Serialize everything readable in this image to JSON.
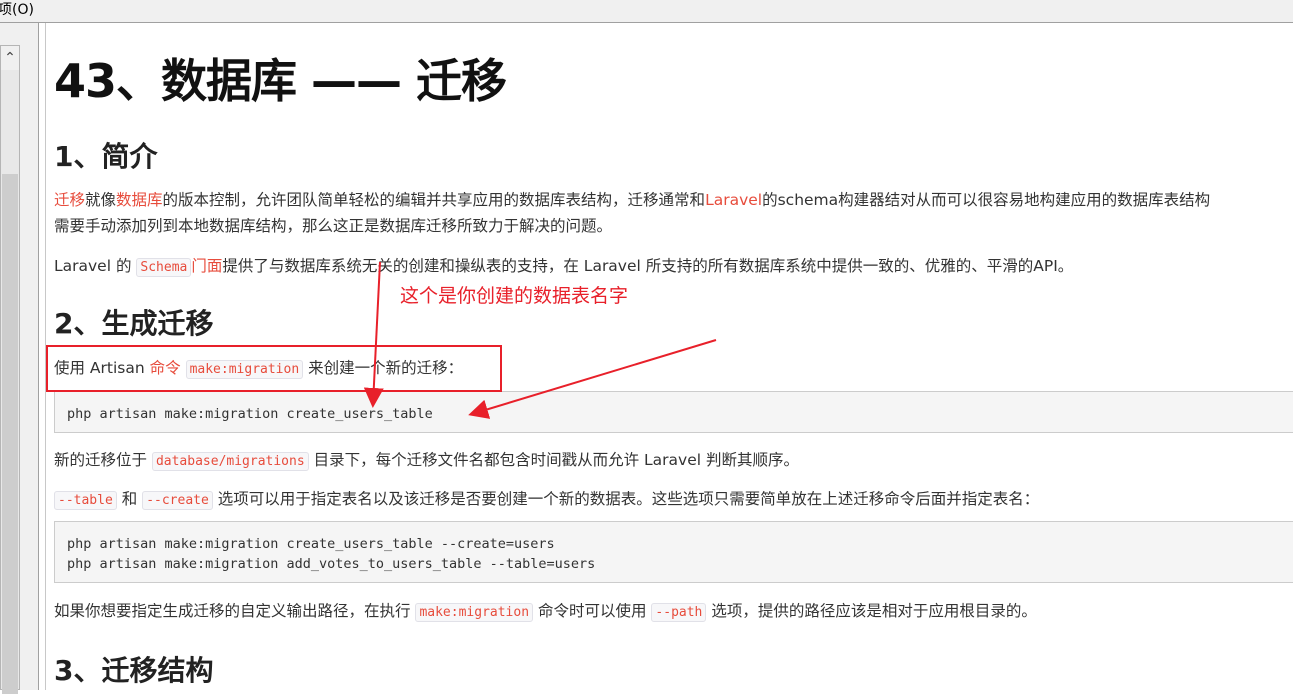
{
  "menubar": {
    "label": "项(O)"
  },
  "doc": {
    "title": "43、数据库 —— 迁移",
    "sections": [
      {
        "heading": "1、简介"
      },
      {
        "heading": "2、生成迁移"
      },
      {
        "heading": "3、迁移结构"
      }
    ],
    "intro": {
      "link1": "迁移",
      "t1": "就像",
      "link2": "数据库",
      "t2": "的版本控制，允许团队简单轻松的编辑并共享应用的数据库表结构，迁移通常和",
      "link3": "Laravel",
      "t3": "的schema构建器结对从而可以很容易地构建应用的数据库表结构",
      "line2": "需要手动添加列到本地数据库结构，那么这正是数据库迁移所致力于解决的问题。"
    },
    "schema_para": {
      "t1": "Laravel 的",
      "code": "Schema",
      "link": "门面",
      "t2": "提供了与数据库系统无关的创建和操纵表的支持，在 Laravel 所支持的所有数据库系统中提供一致的、优雅的、平滑的API。"
    },
    "gen_para": {
      "t1": "使用 Artisan",
      "link": "命令",
      "code": "make:migration",
      "t2": "来创建一个新的迁移："
    },
    "code1": "php artisan make:migration create_users_table",
    "loc_para": {
      "t1": "新的迁移位于",
      "code": "database/migrations",
      "t2": "目录下，每个迁移文件名都包含时间戳从而允许 Laravel 判断其顺序。"
    },
    "opt_para": {
      "code1": "--table",
      "t1": "和",
      "code2": "--create",
      "t2": "选项可以用于指定表名以及该迁移是否要创建一个新的数据表。这些选项只需要简单放在上述迁移命令后面并指定表名："
    },
    "code2_line1": "php artisan make:migration create_users_table --create=users",
    "code2_line2": "php artisan make:migration add_votes_to_users_table --table=users",
    "path_para": {
      "t1": "如果你想要指定生成迁移的自定义输出路径，在执行",
      "code1": "make:migration",
      "t2": "命令时可以使用",
      "code2": "--path",
      "t3": "选项，提供的路径应该是相对于应用根目录的。"
    }
  },
  "annotation": {
    "text": "这个是你创建的数据表名字",
    "color": "#e8202a"
  }
}
